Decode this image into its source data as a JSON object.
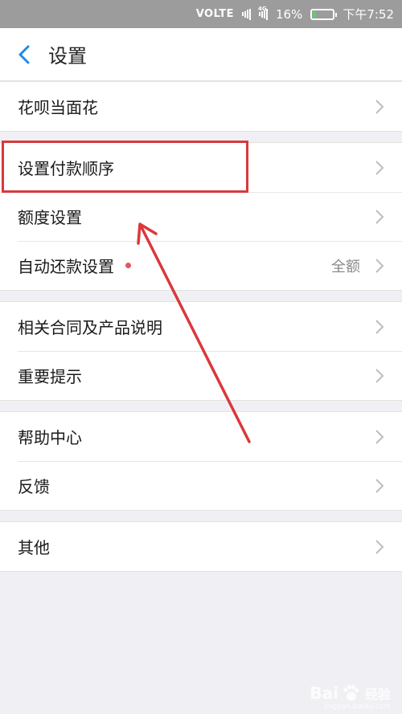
{
  "status_bar": {
    "network": "VOLTE",
    "signal_tag": "4G",
    "battery": "16%",
    "battery_level": 0.16,
    "time": "下午7:52"
  },
  "header": {
    "back_icon": "chevron-left-icon",
    "title": "设置"
  },
  "groups": [
    {
      "items": [
        {
          "label": "花呗当面花"
        }
      ]
    },
    {
      "items": [
        {
          "label": "设置付款顺序"
        },
        {
          "label": "额度设置"
        },
        {
          "label": "自动还款设置",
          "value": "全额",
          "has_dot": true
        }
      ]
    },
    {
      "items": [
        {
          "label": "相关合同及产品说明"
        },
        {
          "label": "重要提示"
        }
      ]
    },
    {
      "items": [
        {
          "label": "帮助中心"
        },
        {
          "label": "反馈"
        }
      ]
    },
    {
      "items": [
        {
          "label": "其他"
        }
      ]
    }
  ],
  "row_chevron_icon": "chevron-right-icon",
  "colors": {
    "accent": "#1e8ae6",
    "annotation": "#d9393c",
    "dot": "#e8545e",
    "background": "#f0f0f4"
  },
  "watermark": {
    "text_left": "Bai",
    "text_right": "经验",
    "url": "jingyan.baidu.com"
  }
}
